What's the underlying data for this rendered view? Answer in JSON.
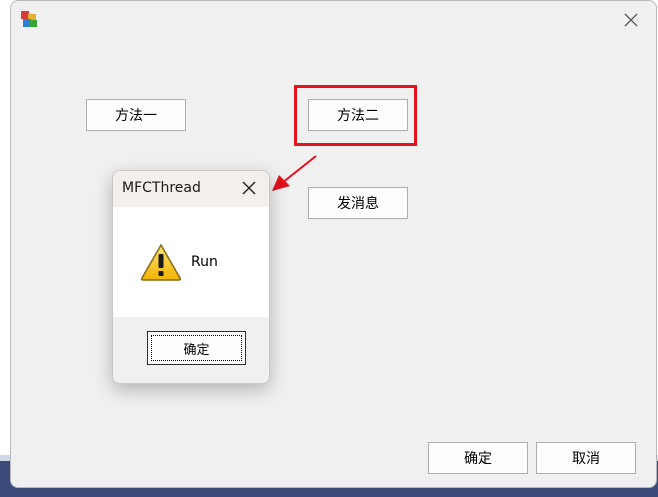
{
  "window": {
    "close_icon": "close-icon",
    "app_icon": "mfc-app-icon"
  },
  "main": {
    "method1_label": "方法一",
    "method2_label": "方法二",
    "send_message_label": "发消息",
    "ok_label": "确定",
    "cancel_label": "取消"
  },
  "message_box": {
    "title": "MFCThread",
    "message": "Run",
    "icon": "warning-icon",
    "ok_label": "确定"
  },
  "annotation": {
    "highlight_color": "#e3101e",
    "arrow_color": "#e3101e"
  }
}
